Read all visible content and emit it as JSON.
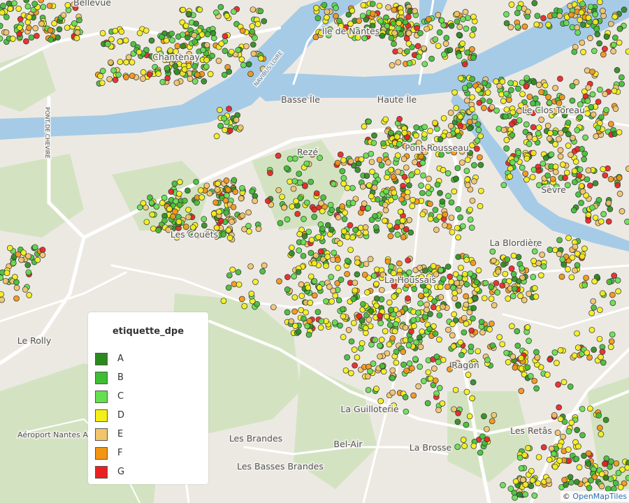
{
  "map": {
    "labels": [
      "Bellevue",
      "Chantenay",
      "Île de Nantes",
      "Basse Île",
      "Haute Île",
      "Rezé",
      "Pont Rousseau",
      "Le Clos Toreau",
      "Sèvre",
      "Les Couëts",
      "La Blordière",
      "La Houssais",
      "Le Rolly",
      "Ragon",
      "La Guilloterie",
      "Les Brandes",
      "Bel-Air",
      "La Brosse",
      "Les Retâs",
      "Les Basses Brandes",
      "Aéroport Nantes Atlantique",
      "PONT DE CHEVIRÉ",
      "NAVIBUS LOIRE"
    ],
    "river_color": "#a6cbe6",
    "land_color": "#ece9e3",
    "green_color": "#cfe0bd",
    "road_color": "#ffffff"
  },
  "legend": {
    "title": "etiquette_dpe",
    "items": [
      {
        "label": "A",
        "color": "#2b8a1e"
      },
      {
        "label": "B",
        "color": "#3fbd34"
      },
      {
        "label": "C",
        "color": "#63df4f"
      },
      {
        "label": "D",
        "color": "#f5ef18"
      },
      {
        "label": "E",
        "color": "#f2c46b"
      },
      {
        "label": "F",
        "color": "#f39412"
      },
      {
        "label": "G",
        "color": "#ea2020"
      }
    ]
  },
  "attribution": {
    "prefix": "© ",
    "link": "OpenMapTiles"
  }
}
